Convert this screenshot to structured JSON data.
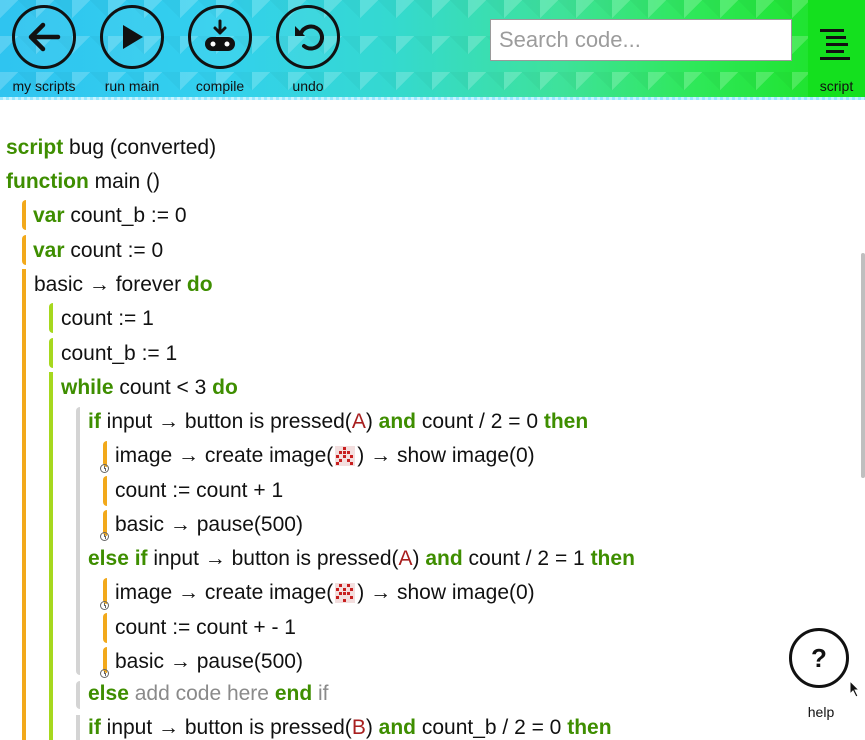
{
  "toolbar": {
    "buttons": [
      {
        "label": "my scripts",
        "icon": "back-arrow-icon"
      },
      {
        "label": "run main",
        "icon": "play-icon"
      },
      {
        "label": "compile",
        "icon": "microbit-download-icon"
      },
      {
        "label": "undo",
        "icon": "undo-icon"
      }
    ],
    "search_placeholder": "Search code...",
    "script_tab": {
      "label": "script",
      "icon": "list-icon"
    }
  },
  "code": {
    "header": {
      "kw": "script",
      "text": " bug (converted)"
    },
    "func": {
      "kw": "function",
      "text": " main ()"
    },
    "var1": {
      "kw": "var",
      "text": " count_b := 0"
    },
    "var2": {
      "kw": "var",
      "text": " count := 0"
    },
    "forever": {
      "a": "basic",
      "b": " forever ",
      "kw": "do"
    },
    "assign1": "count := 1",
    "assign2": "count_b := 1",
    "while": {
      "kw": "while",
      "text": " count < 3 ",
      "kw2": "do"
    },
    "if1": {
      "kw": "if",
      "a": " input",
      "b": " button is pressed(",
      "arg": "A",
      "c": ") ",
      "and": "and",
      "d": " count / 2 = 0 ",
      "then": "then"
    },
    "img1": {
      "a": "image",
      "b": " create image(",
      "c": ")",
      "d": " show image(0)"
    },
    "inc1": "count := count + 1",
    "pause1": {
      "a": "basic",
      "b": " pause(500)"
    },
    "elseif": {
      "kw": "else if",
      "a": " input",
      "b": " button is pressed(",
      "arg": "A",
      "c": ") ",
      "and": "and",
      "d": " count / 2 = 1 ",
      "then": "then"
    },
    "img2": {
      "a": "image",
      "b": " create image(",
      "c": ")",
      "d": " show image(0)"
    },
    "dec1": "count := count +  - 1",
    "pause2": {
      "a": "basic",
      "b": " pause(500)"
    },
    "else": {
      "kw": "else",
      "muted": " add code here ",
      "end": "end",
      "if": " if"
    },
    "if2": {
      "kw": "if",
      "a": " input",
      "b": " button is pressed(",
      "arg": "B",
      "c": ") ",
      "and": "and",
      "d": " count_b / 2 = 0 ",
      "then": "then"
    }
  },
  "help": {
    "label": "help",
    "icon_text": "?"
  },
  "colors": {
    "keyword": "#3e8e00",
    "string": "#a81e1e",
    "orange_bar": "#f2a91b",
    "lime_bar": "#a6d81e",
    "gray_bar": "#d4d4d4"
  }
}
